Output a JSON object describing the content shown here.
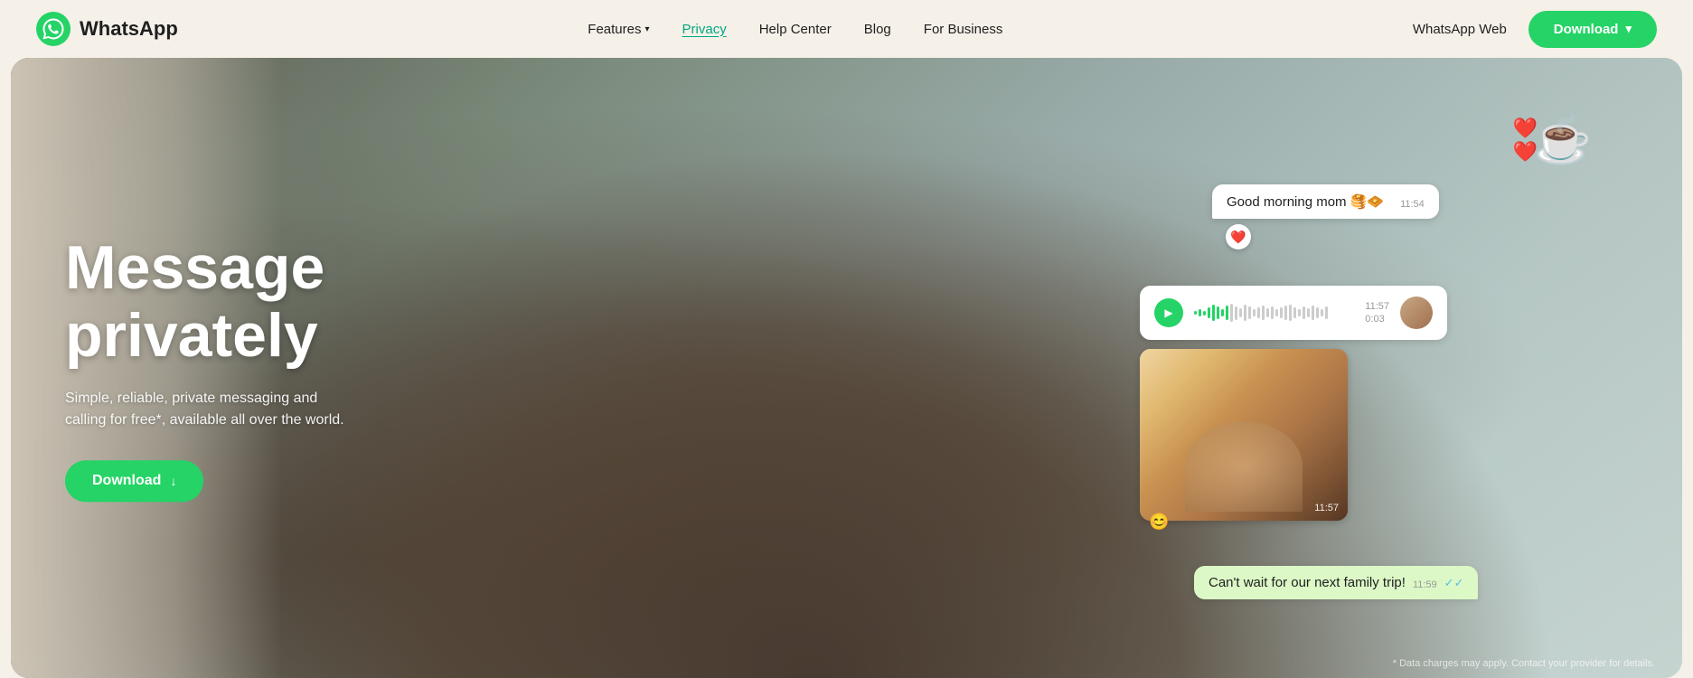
{
  "brand": {
    "name": "WhatsApp",
    "logo_alt": "WhatsApp logo"
  },
  "navbar": {
    "features_label": "Features",
    "privacy_label": "Privacy",
    "help_center_label": "Help Center",
    "blog_label": "Blog",
    "for_business_label": "For Business",
    "whatsapp_web_label": "WhatsApp Web",
    "download_label": "Download"
  },
  "hero": {
    "title_line1": "Message",
    "title_line2": "privately",
    "subtitle": "Simple, reliable, private messaging and calling for free*, available all over the world.",
    "download_label": "Download",
    "footer_note": "* Data charges may apply. Contact your provider for details."
  },
  "chat": {
    "morning_message": "Good morning mom 🥞🧇",
    "morning_time": "11:54",
    "morning_react": "❤️",
    "voice_time_elapsed": "0:03",
    "voice_time_total": "11:57",
    "photo_timestamp": "11:57",
    "photo_react": "😊",
    "family_message": "Can't wait for our next family trip!",
    "family_time": "11:59"
  },
  "sticker": {
    "hearts": "❤️",
    "coffee_cup": "☕"
  },
  "waveform_bars": [
    3,
    8,
    5,
    12,
    18,
    14,
    8,
    16,
    20,
    15,
    10,
    18,
    14,
    8,
    12,
    16,
    10,
    14,
    8,
    12,
    16,
    18,
    12,
    8,
    14,
    10,
    16,
    12,
    8,
    14
  ]
}
